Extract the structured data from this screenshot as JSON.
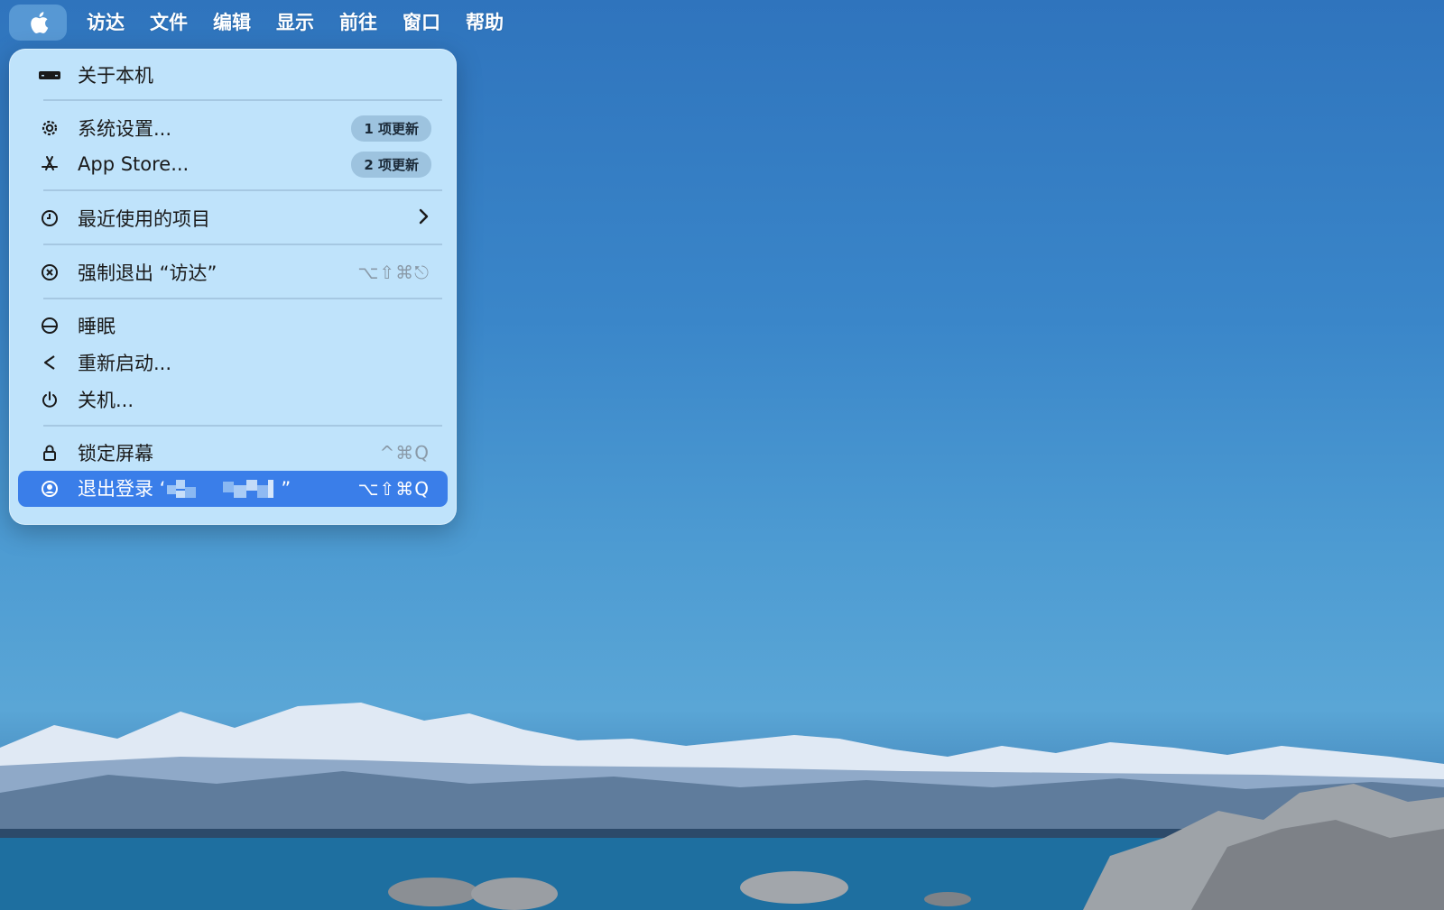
{
  "menubar": {
    "items": [
      "访达",
      "文件",
      "编辑",
      "显示",
      "前往",
      "窗口",
      "帮助"
    ]
  },
  "apple_menu": {
    "about": "关于本机",
    "settings": {
      "label": "系统设置...",
      "badge": "1 项更新"
    },
    "appstore": {
      "label": "App Store...",
      "badge": "2 项更新"
    },
    "recent": "最近使用的项目",
    "force_quit": {
      "label": "强制退出 “访达”",
      "shortcut": "⌥⇧⌘⎋"
    },
    "sleep": "睡眠",
    "restart": "重新启动...",
    "shutdown": "关机...",
    "lock": {
      "label": "锁定屏幕",
      "shortcut": "^⌘Q"
    },
    "logout": {
      "label_prefix": "退出登录 ‘",
      "label_suffix": "”",
      "shortcut": "⌥⇧⌘Q"
    }
  },
  "colors": {
    "highlight": "#3a7ee9",
    "menu_bg": "#bfe3fb"
  }
}
